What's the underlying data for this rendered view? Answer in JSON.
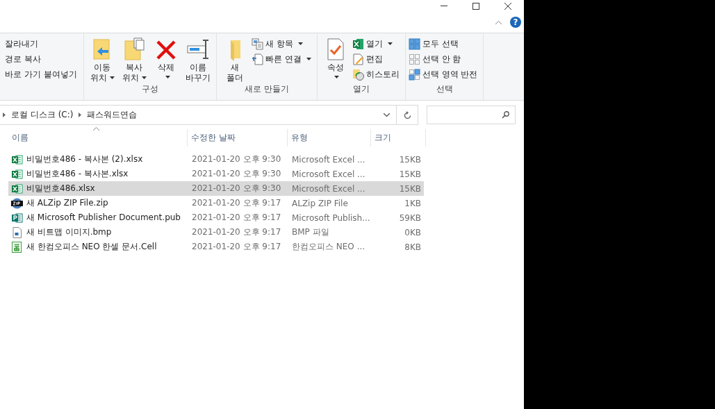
{
  "help": {
    "label": "?"
  },
  "ribbon": {
    "groups": [
      {
        "small": [
          {
            "label": "잘라내기"
          },
          {
            "label": "경로 복사"
          },
          {
            "label": "바로 가기 붙여넣기"
          }
        ]
      },
      {
        "label": "구성",
        "large": [
          {
            "kind": "move",
            "lines": [
              "이동",
              "위치"
            ],
            "dropdown": true
          },
          {
            "kind": "copyto",
            "lines": [
              "복사",
              "위치"
            ],
            "dropdown": true
          },
          {
            "kind": "delete",
            "lines": [
              "삭제"
            ],
            "dropdown": true
          },
          {
            "kind": "rename",
            "lines": [
              "이름",
              "바꾸기"
            ],
            "dropdown": false
          }
        ]
      },
      {
        "label": "새로 만들기",
        "large": [
          {
            "kind": "folder",
            "lines": [
              "새",
              "폴더"
            ],
            "dropdown": false
          }
        ],
        "small": [
          {
            "kind": "newitem",
            "label": "새 항목",
            "dropdown": true
          },
          {
            "kind": "easyaccess",
            "label": "빠른 연결",
            "dropdown": true
          }
        ]
      },
      {
        "label": "열기",
        "large": [
          {
            "kind": "properties",
            "lines": [
              "속성"
            ],
            "dropdown": true
          }
        ],
        "small": [
          {
            "kind": "open",
            "label": "열기",
            "dropdown": true
          },
          {
            "kind": "edit",
            "label": "편집",
            "dropdown": false
          },
          {
            "kind": "history",
            "label": "히스토리",
            "dropdown": false
          }
        ]
      },
      {
        "label": "선택",
        "small": [
          {
            "kind": "selectall",
            "label": "모두 선택",
            "dropdown": false
          },
          {
            "kind": "selectnone",
            "label": "선택 안 함",
            "dropdown": false
          },
          {
            "kind": "invert",
            "label": "선택 영역 반전",
            "dropdown": false
          }
        ]
      }
    ]
  },
  "address": {
    "crumbs": [
      "로컬 디스크 (C:)",
      "패스워드연습"
    ]
  },
  "columns": [
    "이름",
    "수정한 날짜",
    "유형",
    "크기"
  ],
  "rows": [
    {
      "kind": "xlsx",
      "name": "비밀번호486 - 복사본 (2).xlsx",
      "date": "2021-01-20 오후 9:30",
      "type": "Microsoft Excel ...",
      "size": "15KB",
      "selected": false
    },
    {
      "kind": "xlsx",
      "name": "비밀번호486 - 복사본.xlsx",
      "date": "2021-01-20 오후 9:30",
      "type": "Microsoft Excel ...",
      "size": "15KB",
      "selected": false
    },
    {
      "kind": "xlsx",
      "name": "비밀번호486.xlsx",
      "date": "2021-01-20 오후 9:30",
      "type": "Microsoft Excel ...",
      "size": "15KB",
      "selected": true
    },
    {
      "kind": "zip",
      "name": "새 ALZip ZIP File.zip",
      "date": "2021-01-20 오후 9:17",
      "type": "ALZip ZIP File",
      "size": "1KB",
      "selected": false
    },
    {
      "kind": "pub",
      "name": "새 Microsoft Publisher Document.pub",
      "date": "2021-01-20 오후 9:17",
      "type": "Microsoft Publish...",
      "size": "59KB",
      "selected": false
    },
    {
      "kind": "bmp",
      "name": "새 비트맵 이미지.bmp",
      "date": "2021-01-20 오후 9:17",
      "type": "BMP 파일",
      "size": "0KB",
      "selected": false
    },
    {
      "kind": "cell",
      "name": "새 한컴오피스 NEO 한셀 문서.Cell",
      "date": "2021-01-20 오후 9:17",
      "type": "한컴오피스 NEO ...",
      "size": "8KB",
      "selected": false
    }
  ]
}
